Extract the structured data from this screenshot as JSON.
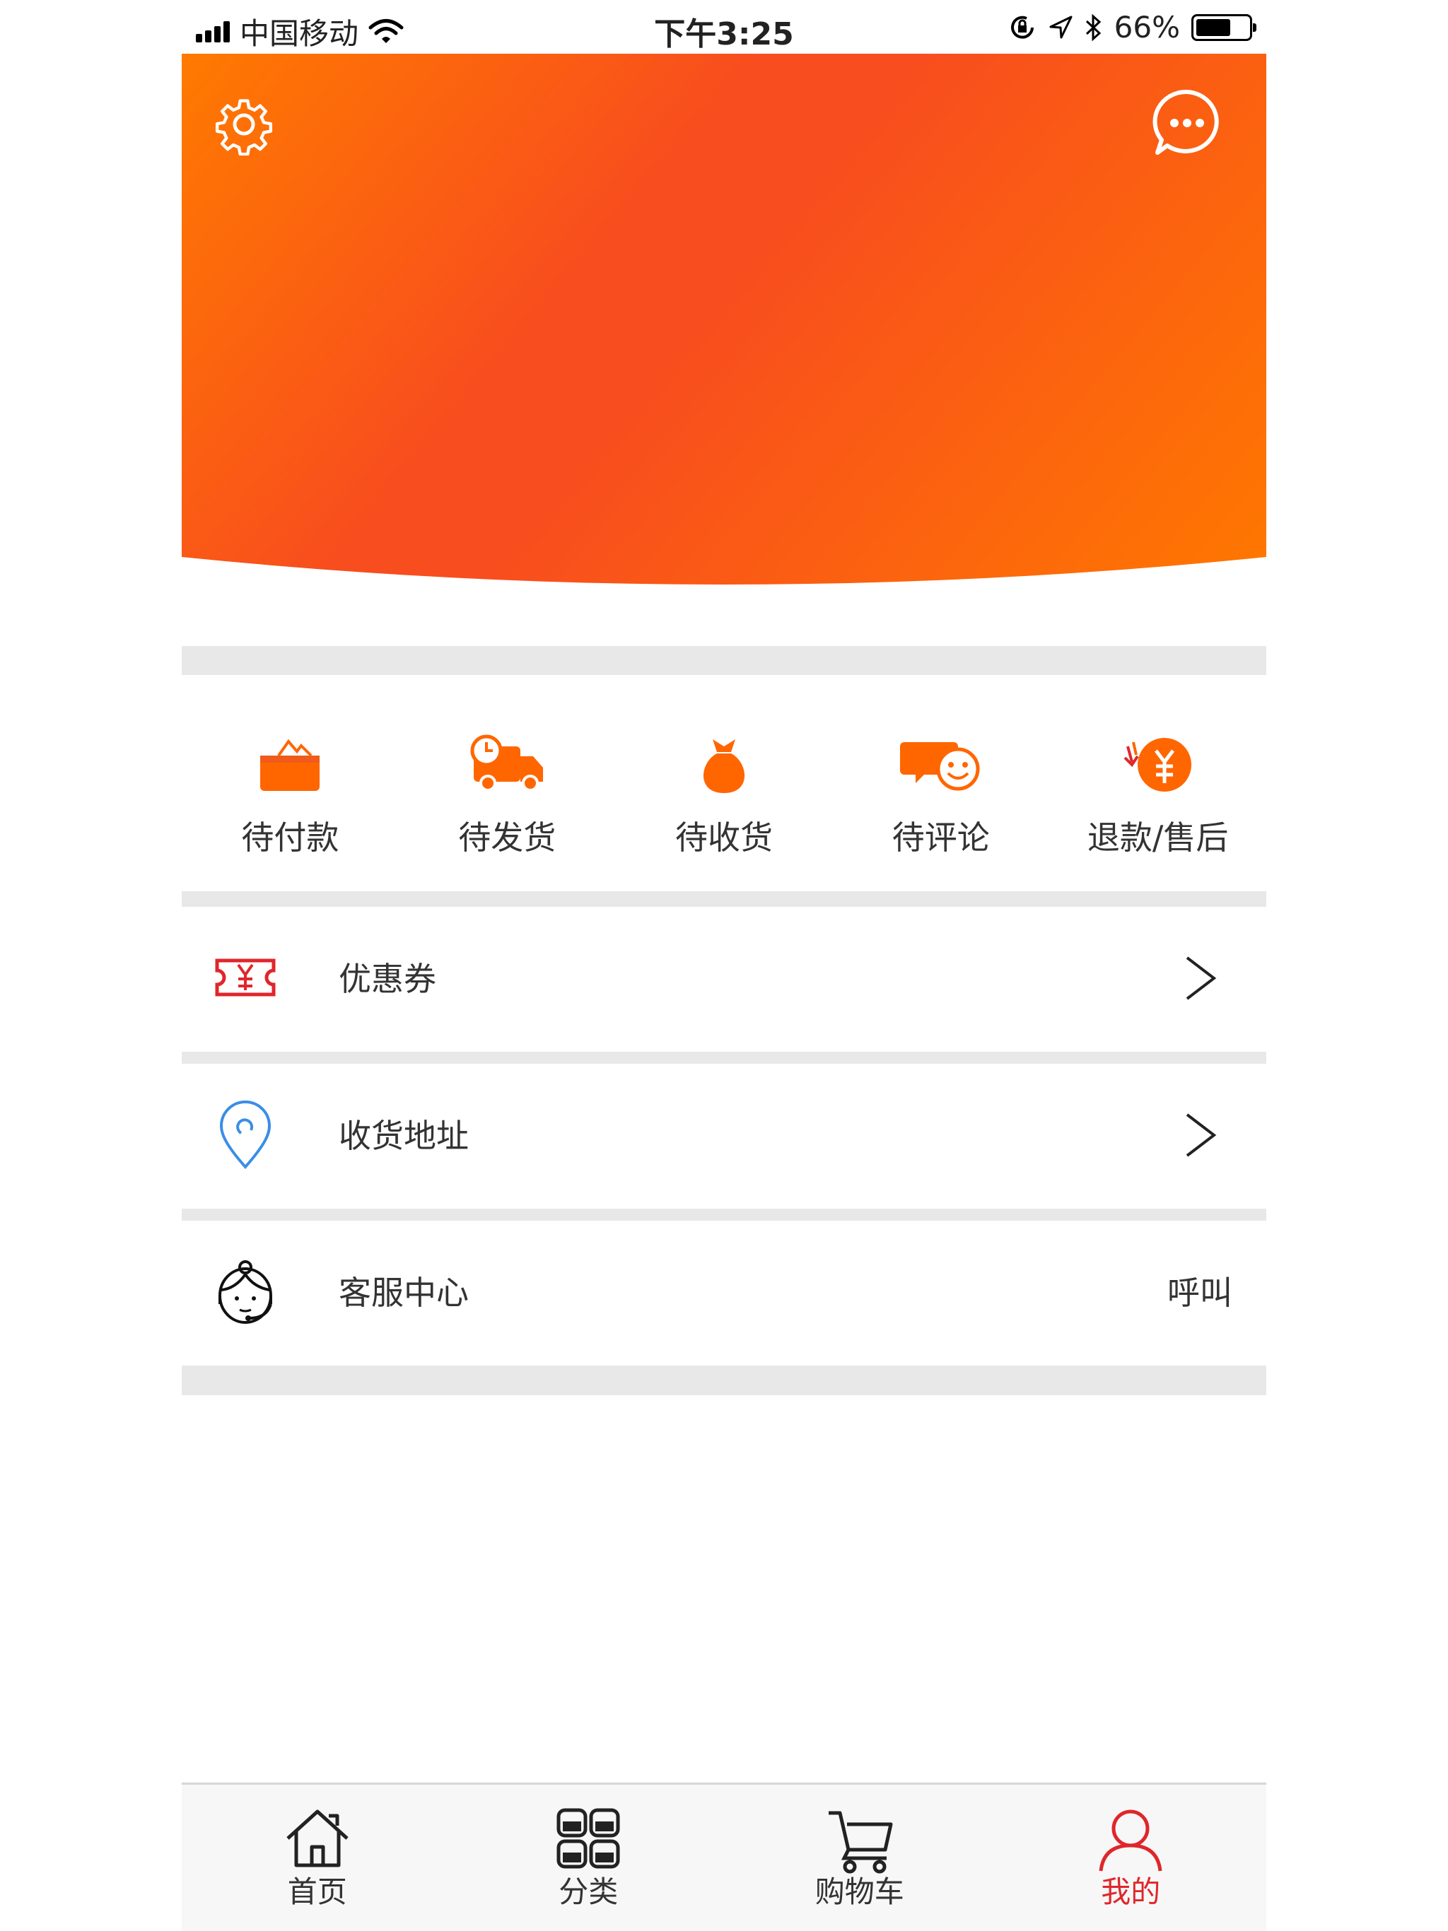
{
  "status_bar": {
    "carrier": "中国移动",
    "time": "下午3:25",
    "battery": "66%",
    "battery_level": 0.66
  },
  "header": {
    "settings_icon": "gear-icon",
    "message_icon": "chat-bubble-icon",
    "gradient_colors": [
      "#ff7a00",
      "#f84d1e",
      "#ff7800"
    ]
  },
  "orders": [
    {
      "label": "待付款",
      "icon": "wallet-icon"
    },
    {
      "label": "待发货",
      "icon": "delivery-truck-icon"
    },
    {
      "label": "待收货",
      "icon": "money-bag-icon"
    },
    {
      "label": "待评论",
      "icon": "review-smiley-icon"
    },
    {
      "label": "退款/售后",
      "icon": "refund-yuan-icon"
    }
  ],
  "menu": {
    "coupons": {
      "label": "优惠券",
      "icon": "coupon-icon"
    },
    "address": {
      "label": "收货地址",
      "icon": "location-pin-icon"
    },
    "service": {
      "label": "客服中心",
      "icon": "customer-service-icon",
      "action": "呼叫"
    }
  },
  "tabbar": [
    {
      "label": "首页",
      "icon": "home-icon",
      "active": false
    },
    {
      "label": "分类",
      "icon": "category-grid-icon",
      "active": false
    },
    {
      "label": "购物车",
      "icon": "cart-icon",
      "active": false
    },
    {
      "label": "我的",
      "icon": "user-icon",
      "active": true
    }
  ],
  "colors": {
    "accent": "#f84d1e",
    "active_tab": "#e0262b",
    "order_icon": "#ff6600",
    "coupon_icon": "#e0262b",
    "address_icon": "#3a8ee6"
  }
}
